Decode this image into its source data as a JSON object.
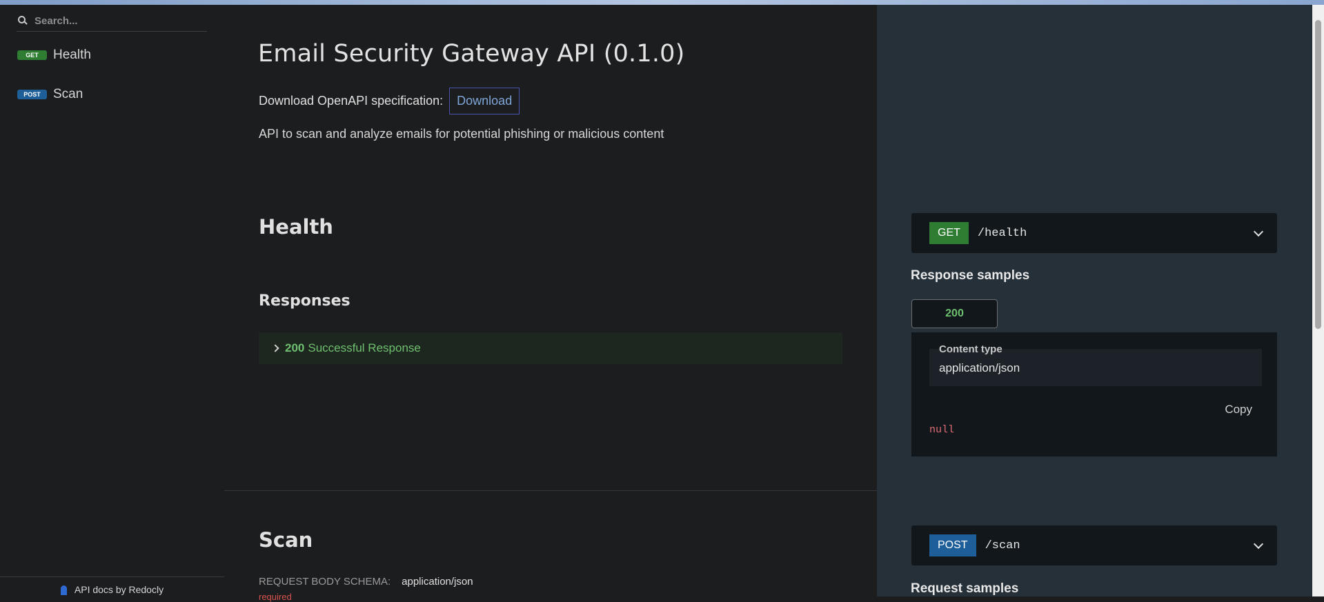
{
  "search": {
    "placeholder": "Search..."
  },
  "sidebar": {
    "items": [
      {
        "method": "GET",
        "label": "Health"
      },
      {
        "method": "POST",
        "label": "Scan"
      }
    ],
    "footer": "API docs by Redocly"
  },
  "main": {
    "title": "Email Security Gateway API (0.1.0)",
    "download_prefix": "Download OpenAPI specification:",
    "download_label": "Download",
    "description": "API to scan and analyze emails for potential phishing or malicious content",
    "health": {
      "heading": "Health",
      "responses_heading": "Responses",
      "response_code": "200",
      "response_text": "Successful Response"
    },
    "scan": {
      "heading": "Scan",
      "request_body_label": "REQUEST BODY SCHEMA:",
      "request_body_value": "application/json",
      "required": "required"
    }
  },
  "right": {
    "health_endpoint": {
      "method": "GET",
      "path": "/health"
    },
    "response_samples_title": "Response samples",
    "status_tab": "200",
    "content_type_label": "Content type",
    "content_type_value": "application/json",
    "copy_label": "Copy",
    "sample_value": "null",
    "scan_endpoint": {
      "method": "POST",
      "path": "/scan"
    },
    "request_samples_title": "Request samples"
  },
  "colors": {
    "get": "#2e7d32",
    "post": "#1f5f99",
    "success": "#6ec06f",
    "link": "#7fa6d8"
  }
}
